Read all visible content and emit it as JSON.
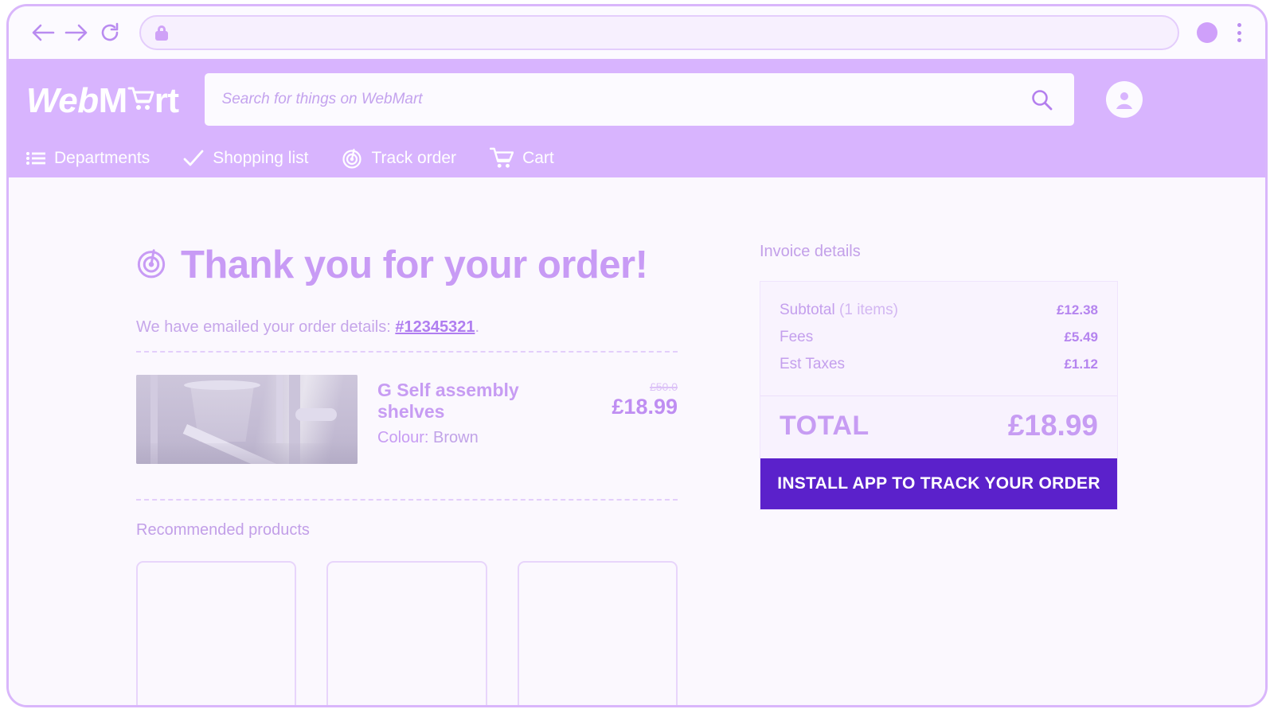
{
  "browser": {
    "back_icon": "back-arrow-icon",
    "forward_icon": "forward-arrow-icon",
    "reload_icon": "reload-icon",
    "lock_icon": "lock-icon",
    "url_value": "",
    "url_placeholder": "",
    "profile_icon": "profile-avatar-icon",
    "menu_icon": "kebab-menu-icon"
  },
  "header": {
    "logo": {
      "part1": "Web",
      "part2": "M",
      "part3": "rt",
      "cart_icon": "shopping-cart-icon"
    },
    "search": {
      "value": "",
      "placeholder": "Search for things on WebMart",
      "icon": "search-icon"
    },
    "account_icon": "account-circle-icon",
    "nav": [
      {
        "label": "Departments",
        "icon": "departments-list-icon"
      },
      {
        "label": "Shopping list",
        "icon": "checkmark-icon"
      },
      {
        "label": "Track order",
        "icon": "track-target-icon"
      },
      {
        "label": "Cart",
        "icon": "shopping-cart-icon"
      }
    ]
  },
  "main": {
    "title": "Thank you for your order!",
    "title_icon": "track-target-icon",
    "email_prefix": "We have emailed your order details: ",
    "order_number": "#12345321",
    "email_suffix": ".",
    "product": {
      "image_alt": "self-assembly-shelves-photo",
      "name": "G Self assembly shelves",
      "colour_label": "Colour:",
      "colour_value": "Brown",
      "price_old": "£50.0",
      "price_new": "£18.99"
    },
    "recommended_title": "Recommended products",
    "recommended_cards": [
      "",
      "",
      ""
    ]
  },
  "invoice": {
    "title": "Invoice details",
    "lines": [
      {
        "label": "Subtotal",
        "sub": "(1 items)",
        "value": "£12.38"
      },
      {
        "label": "Fees",
        "sub": "",
        "value": "£5.49"
      },
      {
        "label": "Est Taxes",
        "sub": "",
        "value": "£1.12"
      }
    ],
    "total_label": "TOTAL",
    "total_value": "£18.99",
    "install_button": "INSTALL APP TO TRACK YOUR ORDER"
  },
  "colors": {
    "header_purple": "#d8b4fe",
    "accent_purple": "#c79cf3",
    "cta_purple": "#5b21cb",
    "page_bg": "#fbf8fe",
    "card_bg": "#f9f3fe"
  }
}
